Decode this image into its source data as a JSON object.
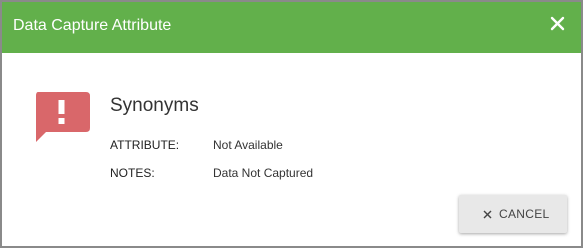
{
  "dialog": {
    "title": "Data Capture Attribute",
    "close_icon": "close-icon",
    "header_color": "#62b04b",
    "alert_icon": "exclamation-alert-icon",
    "alert_color": "#d9676a",
    "content_title": "Synonyms",
    "fields": [
      {
        "label": "ATTRIBUTE:",
        "value": "Not Available"
      },
      {
        "label": "NOTES:",
        "value": "Data Not Captured"
      }
    ],
    "cancel_button": {
      "icon": "close-icon",
      "label": "CANCEL"
    }
  }
}
